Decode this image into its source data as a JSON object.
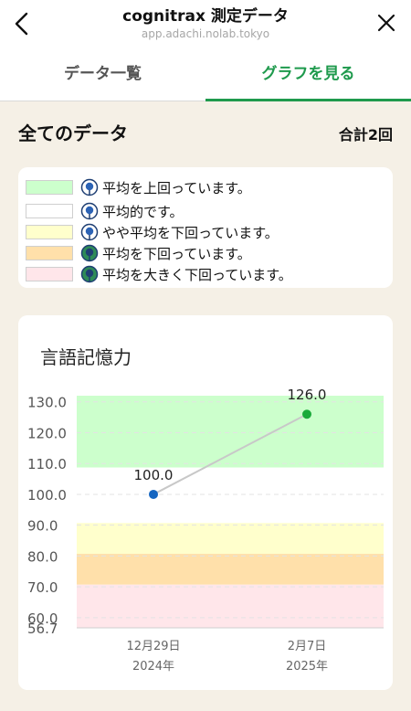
{
  "header": {
    "title": "cognitrax 測定データ",
    "url": "app.adachi.nolab.tokyo",
    "back_icon": "chevron-left-icon",
    "close_icon": "close-icon"
  },
  "tabs": [
    {
      "label": "データ一覧",
      "active": false
    },
    {
      "label": "グラフを見る",
      "active": true,
      "color": "#1f9a4d"
    }
  ],
  "summary": {
    "title": "全てのデータ",
    "count": "合計2回"
  },
  "legend": [
    {
      "label": "平均を上回っています。",
      "color": "#ccffcc",
      "icon": "face-icon-blue"
    },
    {
      "label": "平均的です。",
      "color": "#ffffff",
      "icon": "face-icon-blue"
    },
    {
      "label": "やや平均を下回っています。",
      "color": "#ffffcc",
      "icon": "face-icon-blue"
    },
    {
      "label": "平均を下回っています。",
      "color": "#ffe0aa",
      "icon": "face-icon-green"
    },
    {
      "label": "平均を大きく下回っています。",
      "color": "#ffe6ea",
      "icon": "face-icon-green"
    }
  ],
  "chart_data": {
    "type": "line",
    "title": "言語記憶力",
    "yticks": [
      56.7,
      "60.0",
      "70.0",
      "80.0",
      "90.0",
      "100.0",
      "110.0",
      "120.0",
      "130.0"
    ],
    "ylim": [
      56.7,
      132
    ],
    "bands": [
      {
        "from": 108.7,
        "to": 132,
        "color": "#ccffcc"
      },
      {
        "from": 90.7,
        "to": 108.7,
        "color": "#ffffff"
      },
      {
        "from": 80.7,
        "to": 90.7,
        "color": "#ffffcc"
      },
      {
        "from": 70.7,
        "to": 80.7,
        "color": "#ffe0aa"
      },
      {
        "from": 56.7,
        "to": 70.7,
        "color": "#ffe6ea"
      }
    ],
    "points": [
      {
        "x_label": [
          "12月29日",
          "2024年"
        ],
        "value": 100.0,
        "value_label": "100.0",
        "color": "#1565c0"
      },
      {
        "x_label": [
          "2月7日",
          "2025年"
        ],
        "value": 126.0,
        "value_label": "126.0",
        "color": "#1aaa3a"
      }
    ]
  }
}
